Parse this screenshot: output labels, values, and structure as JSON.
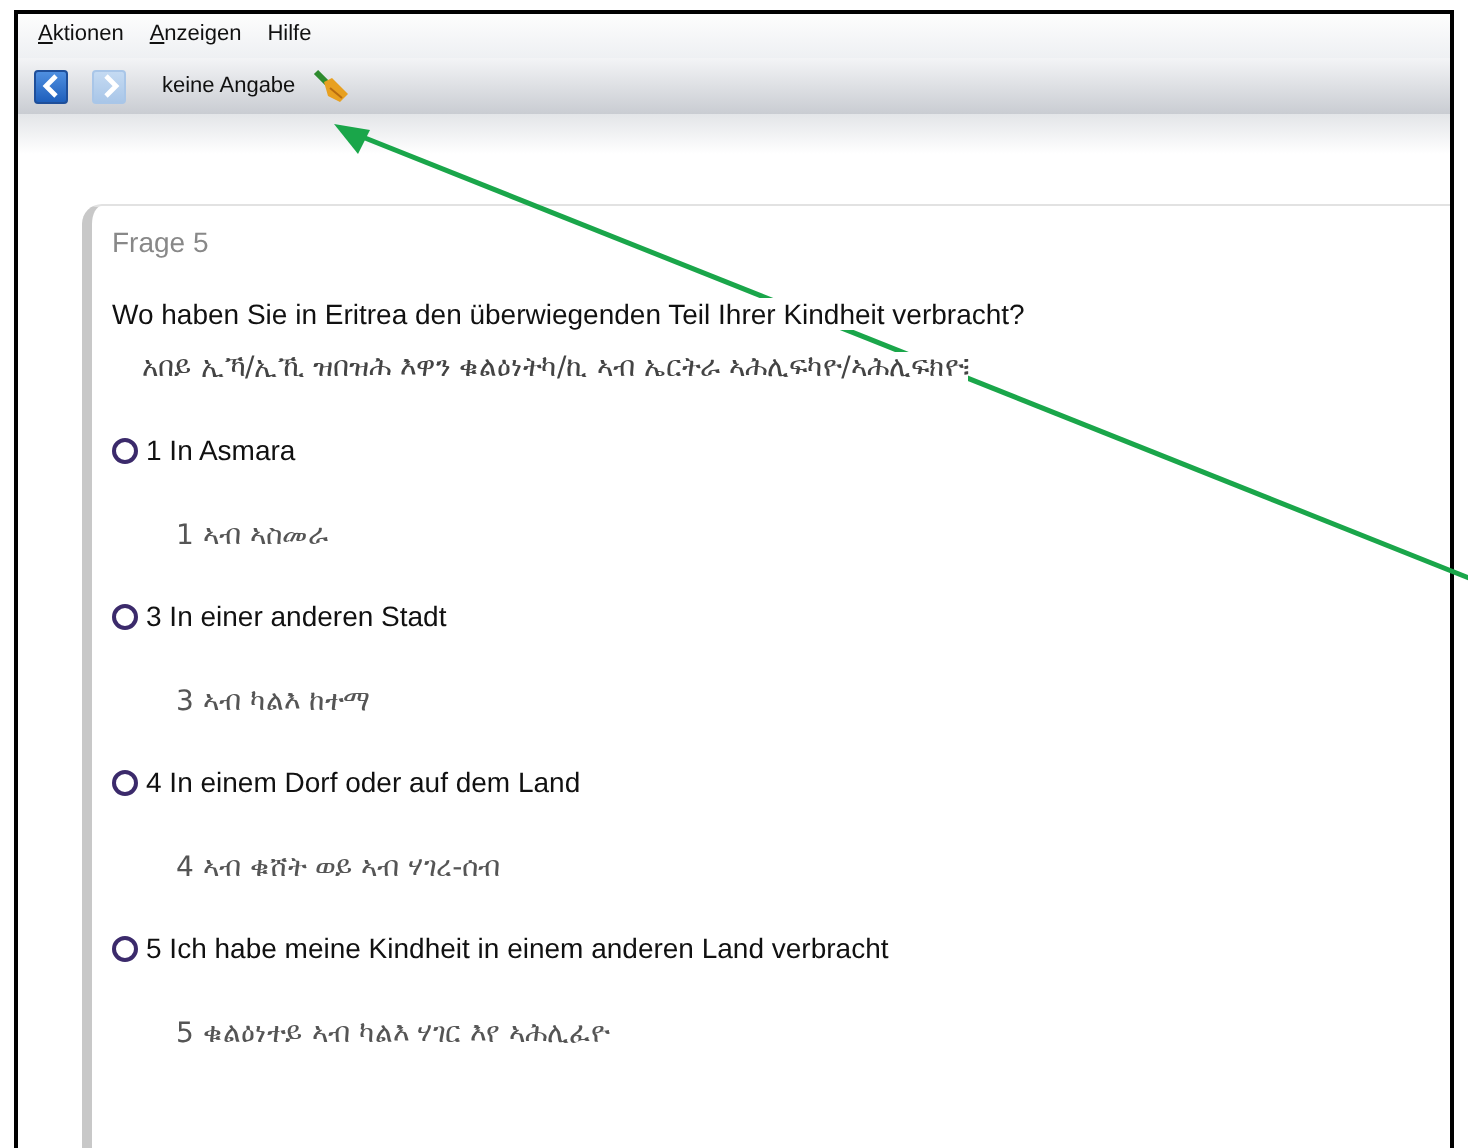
{
  "menu": [
    {
      "label": "Aktionen",
      "mnemonic": true
    },
    {
      "label": "Anzeigen",
      "mnemonic": true
    },
    {
      "label": "Hilfe",
      "mnemonic": false
    }
  ],
  "toolbar": {
    "back": {
      "disabled": false
    },
    "forward": {
      "disabled": true
    },
    "label": "keine Angabe"
  },
  "question": {
    "number": "Frage 5",
    "text": "Wo haben Sie in Eritrea den überwiegenden Teil Ihrer Kindheit verbracht?",
    "translation": "አበይ ኢኻ/ኢኺ ዝበዝሕ እዋን ቁልዕነትካ/ኪ ኣብ ኤርትራ ኣሕሊፍካዮ/ኣሕሊፍክዮ፧",
    "options": [
      {
        "label": "1 In Asmara",
        "translation": "1 ኣብ ኣስመራ",
        "selected": false
      },
      {
        "label": "3 In einer anderen Stadt",
        "translation": "3 ኣብ ካልእ ከተማ",
        "selected": false
      },
      {
        "label": "4 In einem Dorf oder auf dem Land",
        "translation": "4 ኣብ ቁሸት ወይ ኣብ ሃገረ-ሰብ",
        "selected": false
      },
      {
        "label": "5 Ich habe meine Kindheit in einem anderen Land verbracht",
        "translation": "5 ቁልዕነተይ ኣብ ካልእ ሃገር እየ ኣሕሊፈዮ",
        "selected": false
      }
    ]
  }
}
